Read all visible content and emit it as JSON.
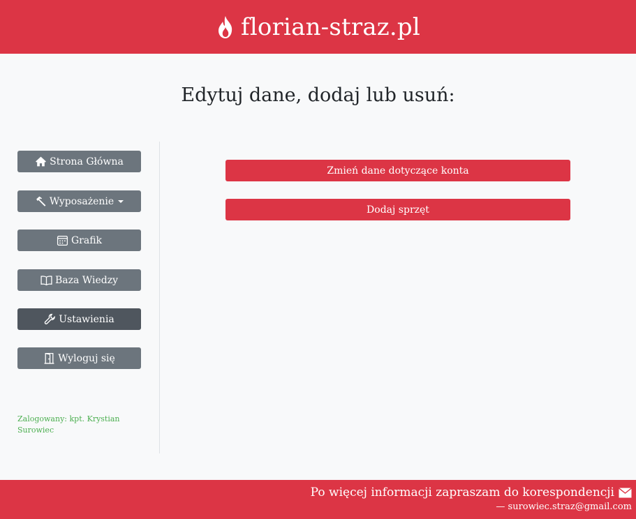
{
  "header": {
    "brand_icon": "fire-icon",
    "brand_text": "florian-straz.pl"
  },
  "page": {
    "title": "Edytuj dane, dodaj lub usuń:"
  },
  "sidebar": {
    "items": [
      {
        "label": "Strona Główna",
        "icon": "home-icon"
      },
      {
        "label": "Wyposażenie",
        "icon": "hammer-icon",
        "dropdown": true
      },
      {
        "label": "Grafik",
        "icon": "calendar-icon"
      },
      {
        "label": "Baza Wiedzy",
        "icon": "book-icon"
      },
      {
        "label": "Ustawienia",
        "icon": "wrench-icon",
        "active": true
      },
      {
        "label": "Wyloguj się",
        "icon": "door-icon"
      }
    ],
    "logged_in": "Zalogowany: kpt. Krystian Surowiec"
  },
  "main": {
    "buttons": [
      {
        "label": "Zmień dane dotyczące konta"
      },
      {
        "label": "Dodaj sprzęt"
      }
    ]
  },
  "footer": {
    "message": "Po więcej informacji zapraszam do korespondencji",
    "mail_icon": "envelope-icon",
    "email": "— surowiec.straz@gmail.com"
  },
  "colors": {
    "accent": "#dc3545",
    "sidebar_button": "#6c757d",
    "sidebar_button_active": "#4f565e",
    "background": "#f8f9fa",
    "logged_text": "#4caf50"
  }
}
